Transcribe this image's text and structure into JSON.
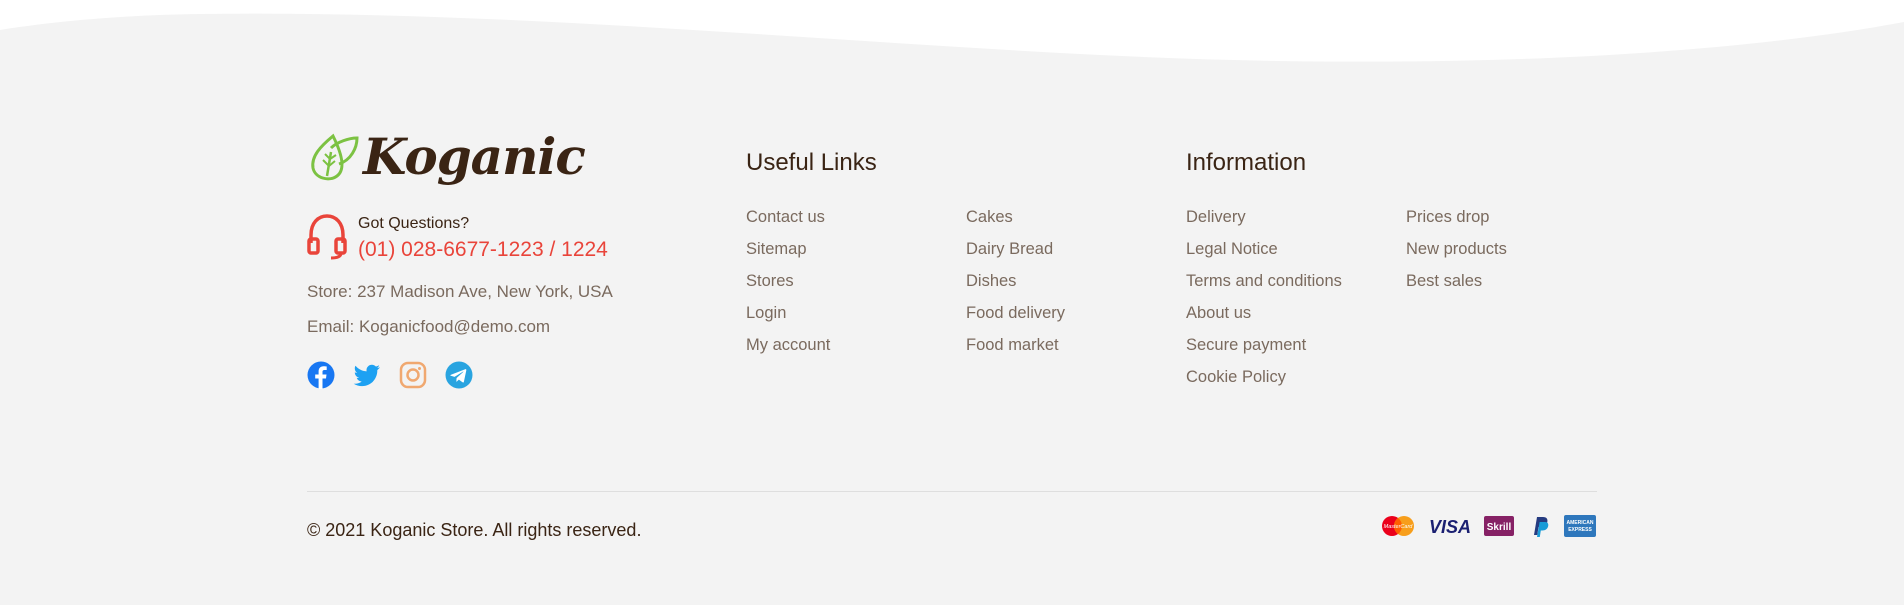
{
  "brand": {
    "name": "Koganic",
    "got_questions": "Got Questions?",
    "phone": "(01) 028-6677-1223 / 1224",
    "address": "Store: 237 Madison Ave, New York, USA",
    "email": "Email: Koganicfood@demo.com"
  },
  "socials": [
    "facebook-icon",
    "twitter-icon",
    "instagram-icon",
    "telegram-icon"
  ],
  "useful_links": {
    "title": "Useful Links",
    "col1": [
      "Contact us",
      "Sitemap",
      "Stores",
      "Login",
      "My account"
    ],
    "col2": [
      "Cakes",
      "Dairy Bread",
      "Dishes",
      "Food delivery",
      "Food market"
    ]
  },
  "information": {
    "title": "Information",
    "col1": [
      "Delivery",
      "Legal Notice",
      "Terms and conditions",
      "About us",
      "Secure payment",
      "Cookie Policy"
    ],
    "col2": [
      "Prices drop",
      "New products",
      "Best sales"
    ]
  },
  "copyright": "© 2021 Koganic Store. All rights reserved.",
  "payments": {
    "icons": [
      "mastercard-icon",
      "visa-icon",
      "skrill-icon",
      "paypal-icon",
      "amex-icon"
    ],
    "mastercard_label": "MasterCard",
    "visa_label": "VISA",
    "skrill_label": "Skrill",
    "amex_label_top": "AMERICAN",
    "amex_label_bottom": "EXPRESS"
  },
  "colors": {
    "background": "#f3f3f3",
    "accent_red": "#e9443a",
    "brand_brown": "#3a2414",
    "leaf_green": "#7cc242",
    "link_gray": "#7a6a5e"
  }
}
